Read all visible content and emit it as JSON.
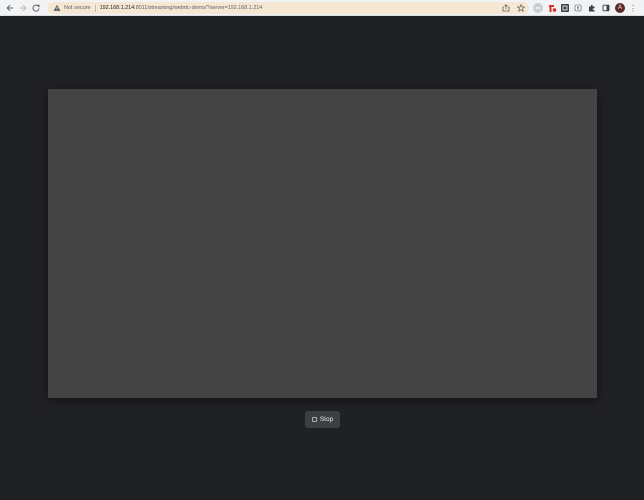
{
  "browser": {
    "security_label": "Not secure",
    "url_host": "192.168.1.214",
    "url_rest": ":8011/streaming/webrtc-demo/?server=192.168.1.214",
    "avatar_initial": "A"
  },
  "icons": {
    "back": "arrow-left-icon",
    "forward": "arrow-right-icon",
    "reload": "reload-icon",
    "warning": "warning-triangle-icon",
    "share": "share-icon",
    "bookmark": "star-icon",
    "extensions": "puzzle-icon",
    "sidebar": "side-panel-icon",
    "menu": "kebab-menu-icon"
  },
  "main": {
    "video_background": "#444444",
    "stop_label": "Stop"
  },
  "colors": {
    "page_background": "#202124",
    "toolbar_background": "#f1f3f4",
    "omnibox_background": "#f6e7d3",
    "button_background": "#3c3f44"
  }
}
